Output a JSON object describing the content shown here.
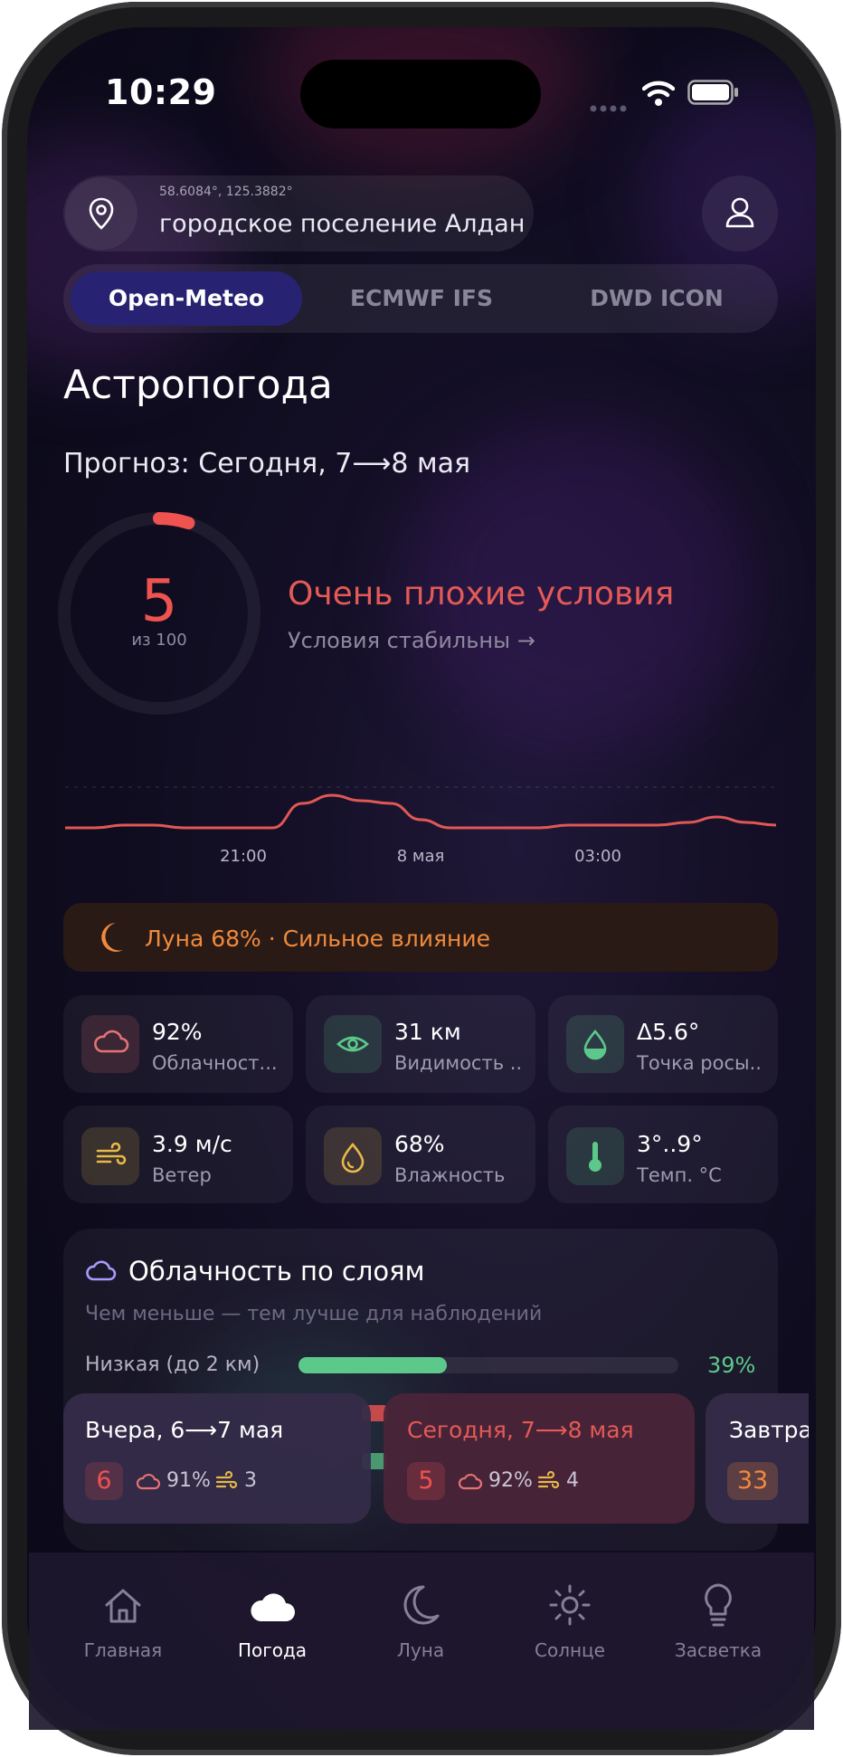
{
  "status_bar": {
    "time": "10:29"
  },
  "location": {
    "coords": "58.6084°, 125.3882°",
    "name": "городское поселение Алдан"
  },
  "models": {
    "tabs": [
      "Open-Meteo",
      "ECMWF IFS",
      "DWD ICON"
    ],
    "active": "Open-Meteo"
  },
  "page": {
    "title": "Астропогода",
    "forecast": "Прогноз: Сегодня, 7⟶8 мая"
  },
  "score": {
    "value": "5",
    "out_of": "из 100",
    "progress": 0.05,
    "condition": "Очень плохие условия",
    "trend": "Условия стабильны →",
    "color": "#ef5350"
  },
  "chart_data": {
    "type": "line",
    "x_ticks": [
      "21:00",
      "8 мая",
      "03:00"
    ],
    "values": [
      5,
      5,
      6,
      6,
      5,
      5,
      5,
      5,
      14,
      17,
      15,
      14,
      8,
      5,
      5,
      5,
      5,
      6,
      6,
      6,
      6,
      7,
      9,
      7,
      6
    ],
    "ylim": [
      0,
      100
    ]
  },
  "moon": {
    "text": "Луна 68% · Сильное влияние"
  },
  "metrics": [
    {
      "value": "92%",
      "label": "Облачност...",
      "icon": "cloud-icon",
      "color": "#e57373"
    },
    {
      "value": "31 км",
      "label": "Видимость ...",
      "icon": "eye-icon",
      "color": "#5cc98a"
    },
    {
      "value": "Δ5.6°",
      "label": "Точка росы...",
      "icon": "drop-icon",
      "color": "#5cc98a"
    },
    {
      "value": "3.9 м/с",
      "label": "Ветер",
      "icon": "wind-icon",
      "color": "#e8b84a"
    },
    {
      "value": "68%",
      "label": "Влажность",
      "icon": "humidity-icon",
      "color": "#e8b84a"
    },
    {
      "value": "3°..9°",
      "label": "Темп. °C",
      "icon": "thermometer-icon",
      "color": "#5cc98a"
    }
  ],
  "layers": {
    "title": "Облачность по слоям",
    "subtitle": "Чем меньше — тем лучше для наблюдений",
    "rows": [
      {
        "label": "Низкая (до 2 км)",
        "value": "39%",
        "fraction": 0.39
      }
    ]
  },
  "days": [
    {
      "title": "Вчера, 6⟶7 мая",
      "score": "6",
      "cloud": "91%",
      "wind": "3",
      "active": false
    },
    {
      "title": "Сегодня, 7⟶8 мая",
      "score": "5",
      "cloud": "92%",
      "wind": "4",
      "active": true
    },
    {
      "title": "Завтра",
      "score": "33",
      "active": false
    }
  ],
  "nav": [
    "Главная",
    "Погода",
    "Луна",
    "Солнце",
    "Засветка"
  ],
  "nav_active": "Погода"
}
